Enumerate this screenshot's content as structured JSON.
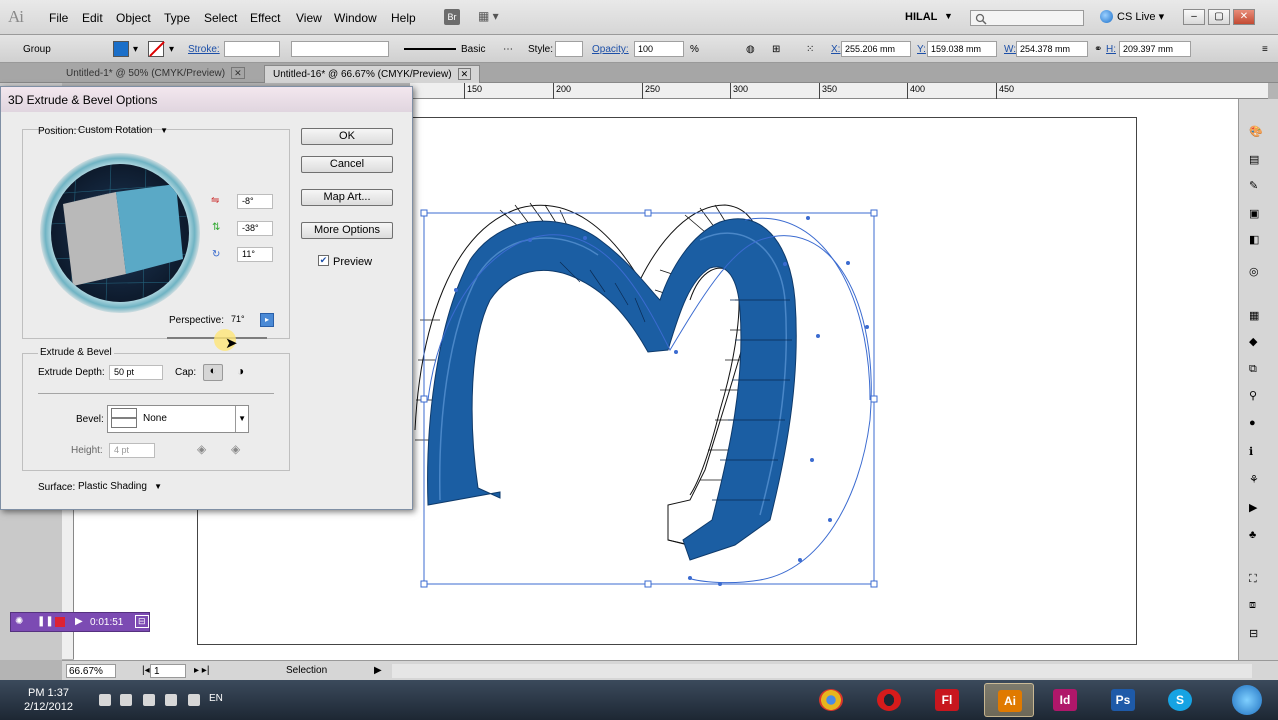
{
  "menubar": {
    "logo": "Ai",
    "items": [
      "File",
      "Edit",
      "Object",
      "Type",
      "Select",
      "Effect",
      "View",
      "Window",
      "Help"
    ],
    "br_button": "Br",
    "workspace": "HILAL",
    "cslive": "CS Live"
  },
  "control": {
    "selection_kind": "Group",
    "stroke_label": "Stroke:",
    "brush": "Basic",
    "style_label": "Style:",
    "opacity_label": "Opacity:",
    "opacity_value": "100",
    "opacity_unit": "%",
    "x_label": "X:",
    "x_value": "255.206 mm",
    "y_label": "Y:",
    "y_value": "159.038 mm",
    "w_label": "W:",
    "w_value": "254.378 mm",
    "h_label": "H:",
    "h_value": "209.397 mm"
  },
  "tabs": [
    {
      "label": "Untitled-1* @ 50% (CMYK/Preview)"
    },
    {
      "label": "Untitled-16* @ 66.67% (CMYK/Preview)"
    }
  ],
  "ruler": {
    "labels": [
      "150",
      "200",
      "250",
      "300",
      "350",
      "400",
      "450"
    ]
  },
  "dialog": {
    "title": "3D Extrude & Bevel Options",
    "position_label": "Position:",
    "position_value": "Custom Rotation",
    "rot_x": "-8°",
    "rot_y": "-38°",
    "rot_z": "11°",
    "perspective_label": "Perspective:",
    "perspective_value": "71°",
    "extrude_group": "Extrude & Bevel",
    "extrude_depth_label": "Extrude Depth:",
    "extrude_depth_value": "50 pt",
    "cap_label": "Cap:",
    "bevel_label": "Bevel:",
    "bevel_value": "None",
    "height_label": "Height:",
    "height_value": "4 pt",
    "surface_label": "Surface:",
    "surface_value": "Plastic Shading",
    "ok": "OK",
    "cancel": "Cancel",
    "map_art": "Map Art...",
    "more_options": "More Options",
    "preview_label": "Preview",
    "preview_checked": true
  },
  "recorder": {
    "time": "0:01:51"
  },
  "status": {
    "zoom": "66.67%",
    "page": "1",
    "tool": "Selection"
  },
  "taskbar": {
    "time": "PM 1:37",
    "date": "2/12/2012",
    "lang": "EN",
    "apps": [
      {
        "name": "chrome-icon",
        "glyph": "",
        "color": "#e8b51e"
      },
      {
        "name": "opera-icon",
        "glyph": "",
        "color": "#d61b1b"
      },
      {
        "name": "flash-icon",
        "glyph": "Fl",
        "color": "#c8161e"
      },
      {
        "name": "illustrator-icon",
        "glyph": "Ai",
        "color": "#e07a00"
      },
      {
        "name": "indesign-icon",
        "glyph": "Id",
        "color": "#b0176a"
      },
      {
        "name": "photoshop-icon",
        "glyph": "Ps",
        "color": "#1e5aa8"
      },
      {
        "name": "skype-icon",
        "glyph": "S",
        "color": "#16a3e3"
      },
      {
        "name": "windows-icon",
        "glyph": "",
        "color": "#3a8fd6"
      }
    ]
  },
  "colors": {
    "fill": "#1b6fc9",
    "art_blue": "#1b5ea3",
    "guide": "#3b6bd0"
  }
}
